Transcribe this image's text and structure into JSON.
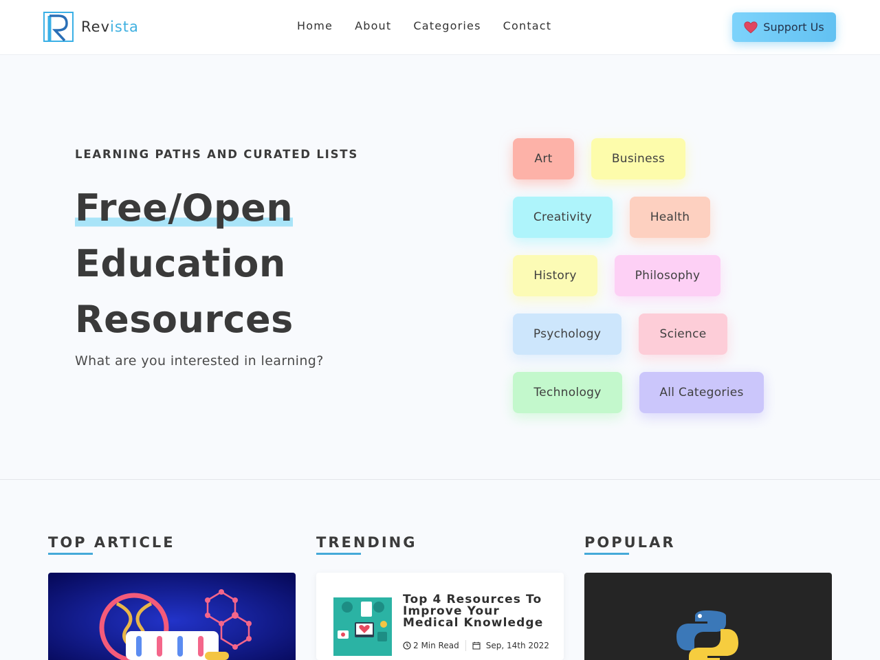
{
  "brand": {
    "name_main": "Rev",
    "name_accent": "ista"
  },
  "nav": {
    "items": [
      "Home",
      "About",
      "Categories",
      "Contact"
    ]
  },
  "support": {
    "label": "Support Us",
    "icon": "heart-icon"
  },
  "hero": {
    "eyebrow": "LEARNING PATHS AND CURATED LISTS",
    "headline_1": "Free/Open",
    "headline_2": "Education",
    "headline_3": "Resources",
    "subtitle": "What are you interested in learning?"
  },
  "categories": [
    {
      "label": "Art",
      "color": "#fdb2a8"
    },
    {
      "label": "Business",
      "color": "#fdfcab"
    },
    {
      "label": "Creativity",
      "color": "#aef4fb"
    },
    {
      "label": "Health",
      "color": "#fdd0c0"
    },
    {
      "label": "History",
      "color": "#fcfbb5"
    },
    {
      "label": "Philosophy",
      "color": "#fdd0f5"
    },
    {
      "label": "Psychology",
      "color": "#cde6fc"
    },
    {
      "label": "Science",
      "color": "#fdcdd8"
    },
    {
      "label": "Technology",
      "color": "#c3f8cc"
    },
    {
      "label": "All Categories",
      "color": "#cbc6fb"
    }
  ],
  "sections": {
    "top_article": "TOP ARTICLE",
    "trending": "TRENDING",
    "popular": "POPULAR"
  },
  "trending_card": {
    "title": "Top 4 Resources To Improve Your Medical Knowledge",
    "read_time": "2 Min Read",
    "date": "Sep, 14th 2022"
  },
  "colors": {
    "accent": "#45a9d8",
    "support_button": "#7dd3fb"
  }
}
